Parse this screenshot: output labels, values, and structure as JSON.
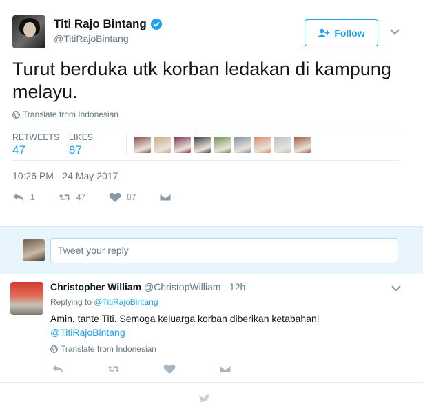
{
  "tweet": {
    "author_name": "Titi Rajo Bintang",
    "author_handle": "@TitiRajoBintang",
    "follow_label": "Follow",
    "text": "Turut berduka utk korban ledakan di kampung melayu.",
    "translate_label": "Translate from Indonesian",
    "stats": {
      "retweets_label": "RETWEETS",
      "retweets_value": "47",
      "likes_label": "LIKES",
      "likes_value": "87"
    },
    "timestamp": "10:26 PM - 24 May 2017",
    "actions": {
      "reply_count": "1",
      "retweet_count": "47",
      "like_count": "87"
    },
    "liker_colors": [
      "#8a4a4a",
      "#c9a98a",
      "#7a3350",
      "#3c3c3c",
      "#6f8f4c",
      "#7d8fa3",
      "#d98a6a",
      "#b7c1cb",
      "#a05a3a"
    ]
  },
  "reply_composer": {
    "placeholder": "Tweet your reply"
  },
  "reply": {
    "author_name": "Christopher William",
    "author_handle": "@ChristopWilliam",
    "separator": "·",
    "time": "12h",
    "replying_to_prefix": "Replying to",
    "replying_to_handle": "@TitiRajoBintang",
    "text": "Amin, tante Titi. Semoga keluarga korban diberikan ketabahan!",
    "mention": "@TitiRajoBintang",
    "translate_label": "Translate from Indonesian"
  },
  "colors": {
    "accent": "#1da1f2",
    "muted": "#657786",
    "reply_bg": "#e8f5fd"
  }
}
